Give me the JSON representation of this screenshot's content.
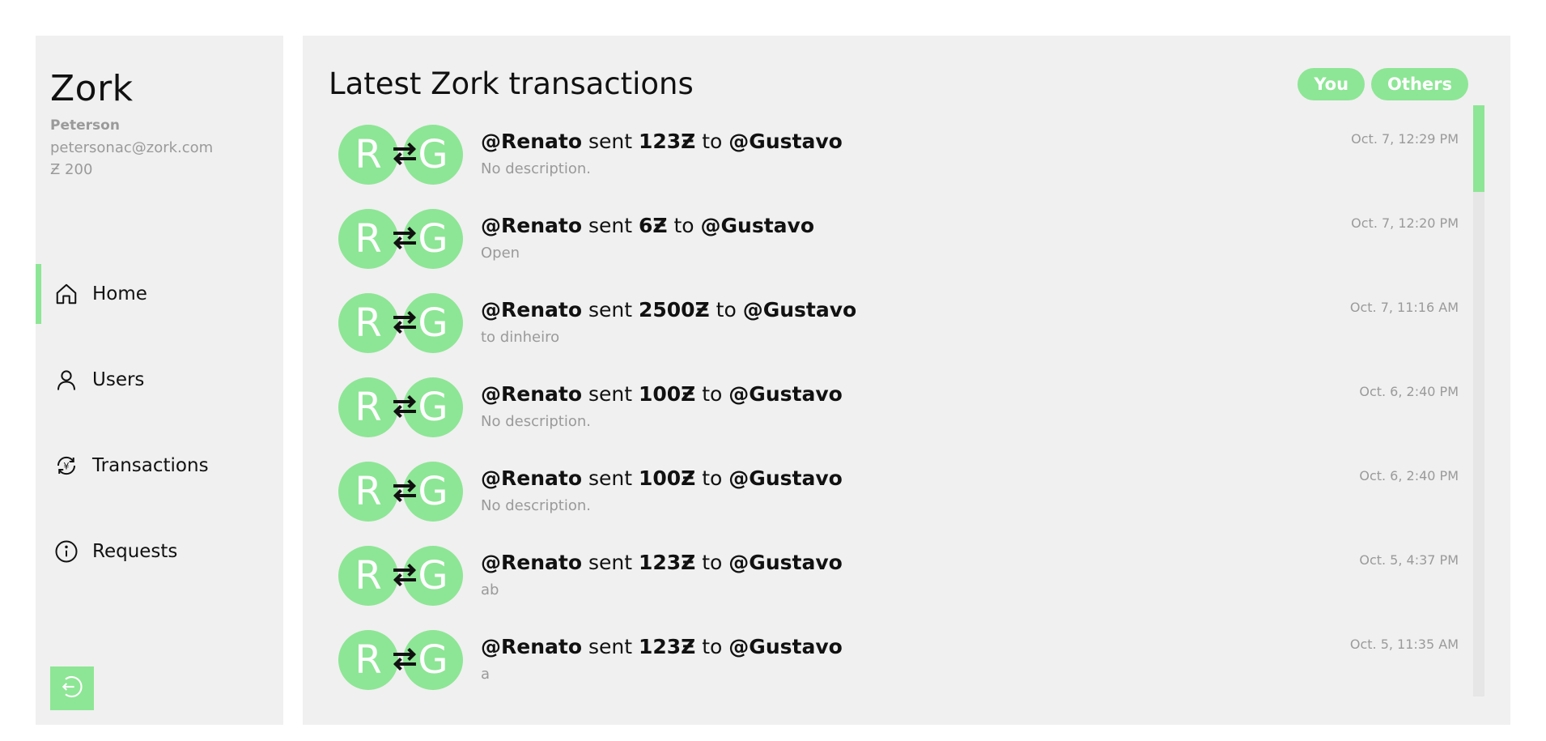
{
  "sidebar": {
    "brand": "Zork",
    "user": {
      "name": "Peterson",
      "email": "petersonac@zork.com",
      "balance": "Ƶ 200"
    },
    "nav": [
      {
        "label": "Home",
        "icon": "home-icon",
        "active": true
      },
      {
        "label": "Users",
        "icon": "user-icon",
        "active": false
      },
      {
        "label": "Transactions",
        "icon": "transactions-icon",
        "active": false
      },
      {
        "label": "Requests",
        "icon": "info-icon",
        "active": false
      }
    ],
    "logout_icon": "logout-icon"
  },
  "main": {
    "title": "Latest Zork transactions",
    "filters": [
      "You",
      "Others"
    ],
    "transactions": [
      {
        "from_initial": "R",
        "to_initial": "G",
        "from": "@Renato",
        "verb": "sent",
        "amount": "123Ƶ",
        "connector": "to",
        "to": "@Gustavo",
        "description": "No description.",
        "time": "Oct. 7, 12:29 PM"
      },
      {
        "from_initial": "R",
        "to_initial": "G",
        "from": "@Renato",
        "verb": "sent",
        "amount": "6Ƶ",
        "connector": "to",
        "to": "@Gustavo",
        "description": "Open",
        "time": "Oct. 7, 12:20 PM"
      },
      {
        "from_initial": "R",
        "to_initial": "G",
        "from": "@Renato",
        "verb": "sent",
        "amount": "2500Ƶ",
        "connector": "to",
        "to": "@Gustavo",
        "description": "to dinheiro",
        "time": "Oct. 7, 11:16 AM"
      },
      {
        "from_initial": "R",
        "to_initial": "G",
        "from": "@Renato",
        "verb": "sent",
        "amount": "100Ƶ",
        "connector": "to",
        "to": "@Gustavo",
        "description": "No description.",
        "time": "Oct. 6, 2:40 PM"
      },
      {
        "from_initial": "R",
        "to_initial": "G",
        "from": "@Renato",
        "verb": "sent",
        "amount": "100Ƶ",
        "connector": "to",
        "to": "@Gustavo",
        "description": "No description.",
        "time": "Oct. 6, 2:40 PM"
      },
      {
        "from_initial": "R",
        "to_initial": "G",
        "from": "@Renato",
        "verb": "sent",
        "amount": "123Ƶ",
        "connector": "to",
        "to": "@Gustavo",
        "description": "ab",
        "time": "Oct. 5, 4:37 PM"
      },
      {
        "from_initial": "R",
        "to_initial": "G",
        "from": "@Renato",
        "verb": "sent",
        "amount": "123Ƶ",
        "connector": "to",
        "to": "@Gustavo",
        "description": "a",
        "time": "Oct. 5, 11:35 AM"
      }
    ]
  },
  "colors": {
    "accent": "#8de695",
    "panel": "#f0f0f0",
    "muted": "#9a9a9a"
  }
}
